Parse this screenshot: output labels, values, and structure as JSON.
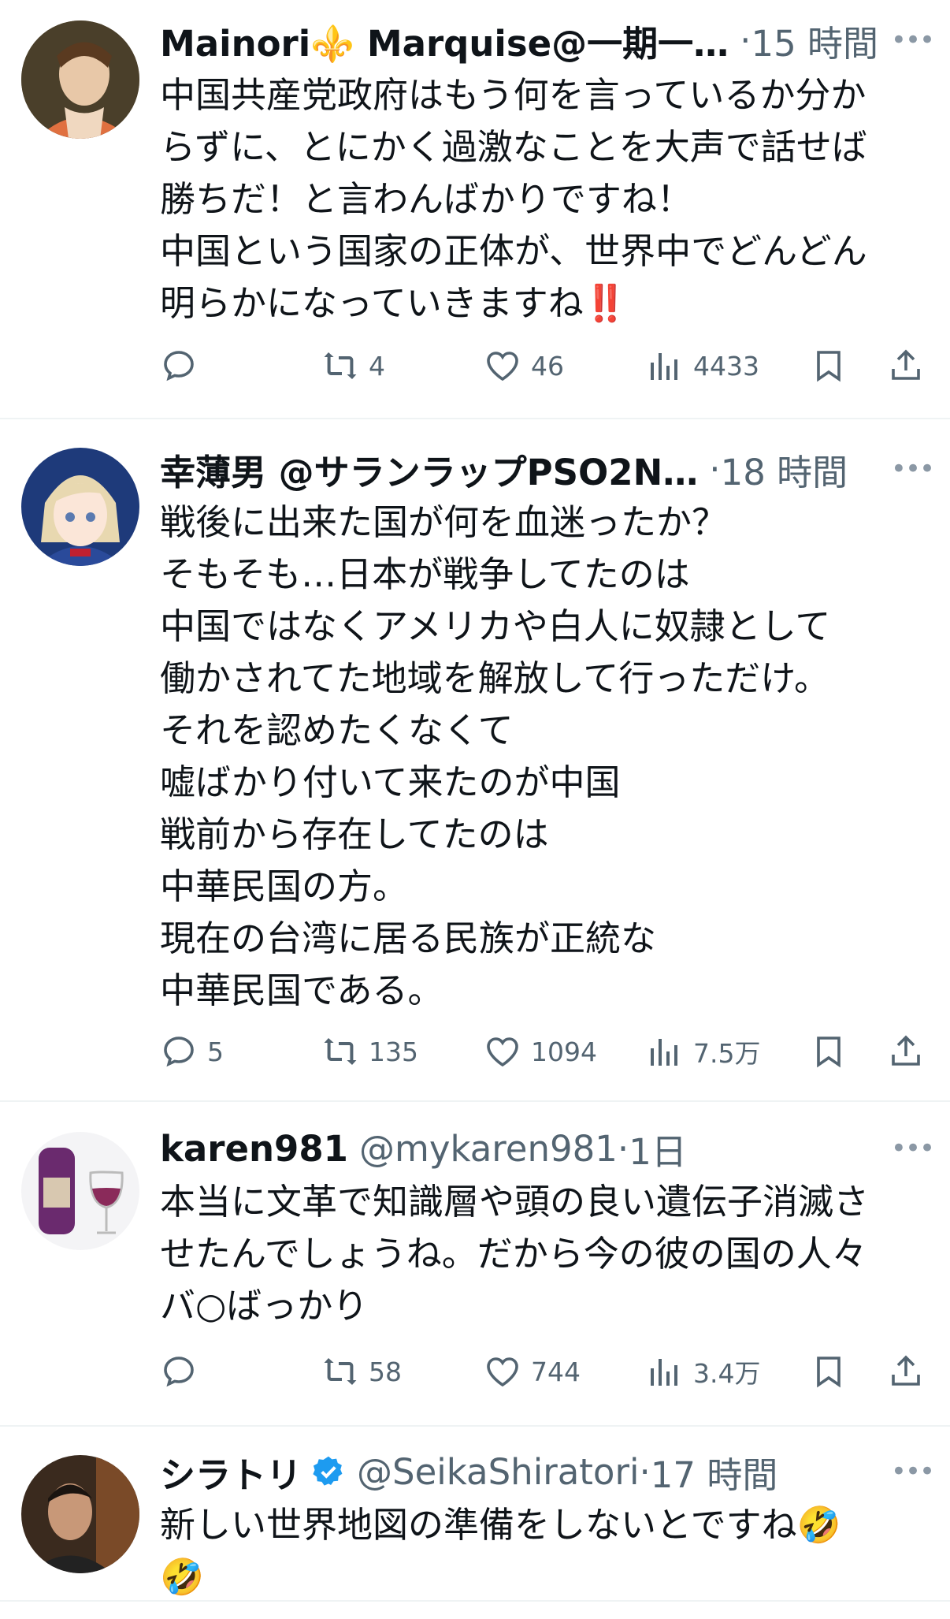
{
  "tweets": [
    {
      "name": "Mainori⚜️ Marquise@一期一…",
      "handle": "",
      "sep": "·",
      "time": "15 時間",
      "lines": [
        "中国共産党政府はもう何を言っているか分か",
        "らずに、とにかく過激なことを大声で話せば",
        "勝ちだ！と言わんばかりですね！",
        "中国という国家の正体が、世界中でどんどん",
        "明らかになっていきますね‼️"
      ],
      "replies": "",
      "retweets": "4",
      "likes": "46",
      "views": "4433"
    },
    {
      "name": "幸薄男 @サランラップPSO2N…",
      "handle": "",
      "sep": "·",
      "time": "18 時間",
      "lines": [
        "戦後に出来た国が何を血迷ったか？",
        "そもそも…日本が戦争してたのは",
        "中国ではなくアメリカや白人に奴隷として",
        "働かされてた地域を解放して行っただけ。",
        "それを認めたくなくて",
        "嘘ばかり付いて来たのが中国",
        "戦前から存在してたのは",
        "中華民国の方。",
        "現在の台湾に居る民族が正統な",
        "中華民国である。"
      ],
      "replies": "5",
      "retweets": "135",
      "likes": "1094",
      "views": "7.5万"
    },
    {
      "name": "karen981",
      "handle": "@mykaren981",
      "sep": "·",
      "time": "1日",
      "lines": [
        "本当に文革で知識層や頭の良い遺伝子消滅さ",
        "せたんでしょうね。だから今の彼の国の人々",
        "バ○ばっかり"
      ],
      "replies": "",
      "retweets": "58",
      "likes": "744",
      "views": "3.4万"
    },
    {
      "name": "シラトリ",
      "handle": "@SeikaShiratori",
      "sep": "·",
      "time": "17 時間",
      "verified": true,
      "lines": [
        "新しい世界地図の準備をしないとですね🤣",
        "🤣"
      ]
    }
  ],
  "icons": {
    "reply": "reply-icon",
    "retweet": "retweet-icon",
    "like": "heart-icon",
    "views": "views-chart-icon",
    "bookmark": "bookmark-icon",
    "share": "share-icon",
    "more": "more-icon",
    "verified": "verified-badge-icon"
  },
  "colors": {
    "text": "#0f1419",
    "secondary": "#536471",
    "divider": "#eff3f4",
    "verified": "#1d9bf0"
  }
}
